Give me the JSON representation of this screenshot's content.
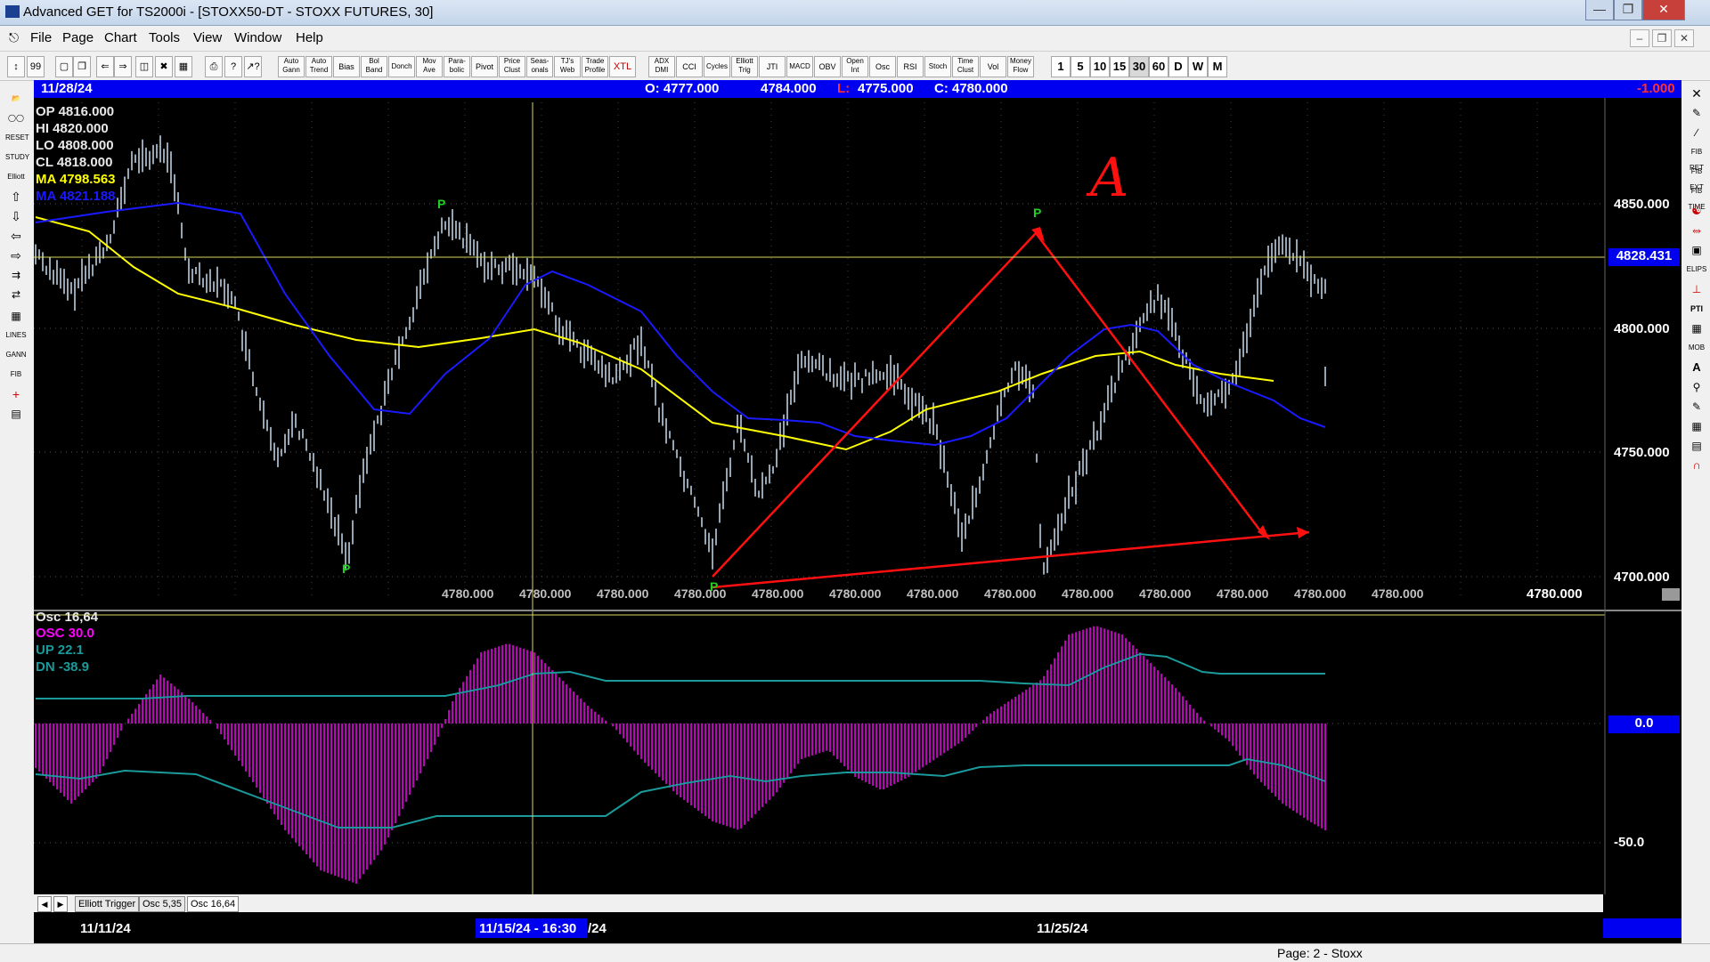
{
  "window": {
    "title": "Advanced GET for TS2000i - [STOXX50-DT - STOXX FUTURES, 30]"
  },
  "menu": {
    "items": [
      "File",
      "Page",
      "Chart",
      "Tools",
      "View",
      "Window",
      "Help"
    ]
  },
  "toolbar": {
    "buttons": [
      "Auto Gann",
      "Auto Trend",
      "Bias",
      "Bol Band",
      "Donch",
      "Mov Ave",
      "Para- bolic",
      "Pivot",
      "Price Clust",
      "Seas- onals",
      "TJ's Web",
      "Trade Profile",
      "XTL",
      "ADX DMI",
      "CCI",
      "Cycles",
      "Elliott Trig",
      "JTI",
      "MACD",
      "OBV",
      "Open Int",
      "Osc",
      "RSI",
      "Stoch",
      "Time Clust",
      "Vol",
      "Money Flow"
    ],
    "intervals": [
      "1",
      "5",
      "10",
      "15",
      "30",
      "60",
      "D",
      "W",
      "M"
    ]
  },
  "info_bar": {
    "date": "11/28/24",
    "open": "O: 4777.000",
    "high": "4784.000",
    "low_label": "L:",
    "low": "4775.000",
    "close": "C: 4780.000",
    "change": "-1.000"
  },
  "legend": {
    "op": "OP  4816.000",
    "hi": "HI   4820.000",
    "lo": "LO  4808.000",
    "cl": "CL  4818.000",
    "ma1": "MA  4798.563",
    "ma2": "MA  4821.188"
  },
  "price_axis": {
    "labels": [
      "4850.000",
      "4800.000",
      "4750.000",
      "4700.000"
    ],
    "crosshair_price": "4828.431",
    "bottom_price": "4780.000"
  },
  "bottom_price_labels": [
    "4780.000",
    "4780.000",
    "4780.000",
    "4780.000",
    "4780.000",
    "4780.000",
    "4780.000",
    "4780.000",
    "4780.000",
    "4780.000",
    "4780.000",
    "4780.000",
    "4780.000"
  ],
  "pivot_label": "P",
  "annotation_letter": "A",
  "osc": {
    "title": "Osc 16,64",
    "osc": "OSC 30.0",
    "up": "UP   22.1",
    "dn": "DN   -38.9",
    "zero_label": "0.0",
    "minus50_label": "-50.0"
  },
  "tabs": [
    "Elliott Trigger",
    "Osc 5,35",
    "Osc 16,64"
  ],
  "dates": {
    "d1": "11/11/24",
    "d2": "11/15/24 - 16:30",
    "d2b": "/24",
    "d3": "11/25/24"
  },
  "status": {
    "page": "Page: 2 - Stoxx"
  },
  "colors": {
    "price_bars": "#c8dcf0",
    "ma_yellow": "#ffff00",
    "ma_blue": "#1a1aff",
    "osc_magenta": "#ff00ff",
    "band_teal": "#1a9a9a",
    "annotation_red": "#ff1010",
    "info_blue": "#0000f0"
  }
}
